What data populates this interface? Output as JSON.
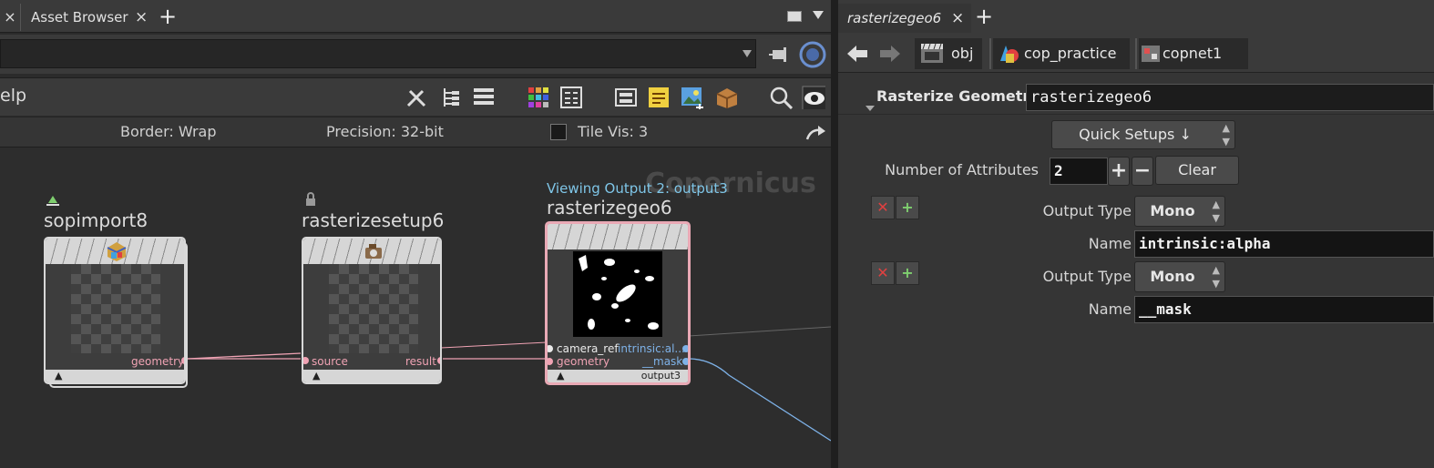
{
  "left_pane": {
    "tabs": [
      {
        "close": "×"
      },
      {
        "label": "Asset Browser",
        "close": "×"
      }
    ],
    "add_tab": "+",
    "menu_partial": "elp",
    "info": {
      "border": "Border: Wrap",
      "precision": "Precision: 32-bit",
      "tile_vis": "Tile Vis: 3"
    },
    "watermark": "Copernicus",
    "nodes": [
      {
        "name": "sopimport8",
        "out_port": "geometry"
      },
      {
        "name": "rasterizesetup6",
        "in_port": "source",
        "out_port": "result"
      },
      {
        "name": "rasterizegeo6",
        "status": "Viewing Output 2: output3",
        "in_ports": [
          "camera_ref",
          "geometry"
        ],
        "out_ports": [
          "intrinsic:al...",
          "__mask"
        ],
        "footer": "output3"
      }
    ]
  },
  "right_pane": {
    "tab": {
      "label": "rasterizegeo6",
      "close": "×"
    },
    "add_tab": "+",
    "breadcrumbs": [
      "obj",
      "cop_practice",
      "copnet1"
    ],
    "node_type": "Rasterize Geometry",
    "node_name": "rasterizegeo6",
    "quick_setups": "Quick Setups ↓",
    "num_attributes_label": "Number of Attributes",
    "num_attributes_value": "2",
    "plus": "+",
    "minus": "−",
    "clear": "Clear",
    "attributes": [
      {
        "output_type_label": "Output Type",
        "output_type": "Mono",
        "name_label": "Name",
        "name": "intrinsic:alpha"
      },
      {
        "output_type_label": "Output Type",
        "output_type": "Mono",
        "name_label": "Name",
        "name": "__mask"
      }
    ]
  },
  "colors": {
    "wire_pink": "#f0a3b4",
    "wire_blue": "#7eb2e8",
    "selected_node": "#e9a9b5",
    "status_text": "#7fc6e8"
  }
}
